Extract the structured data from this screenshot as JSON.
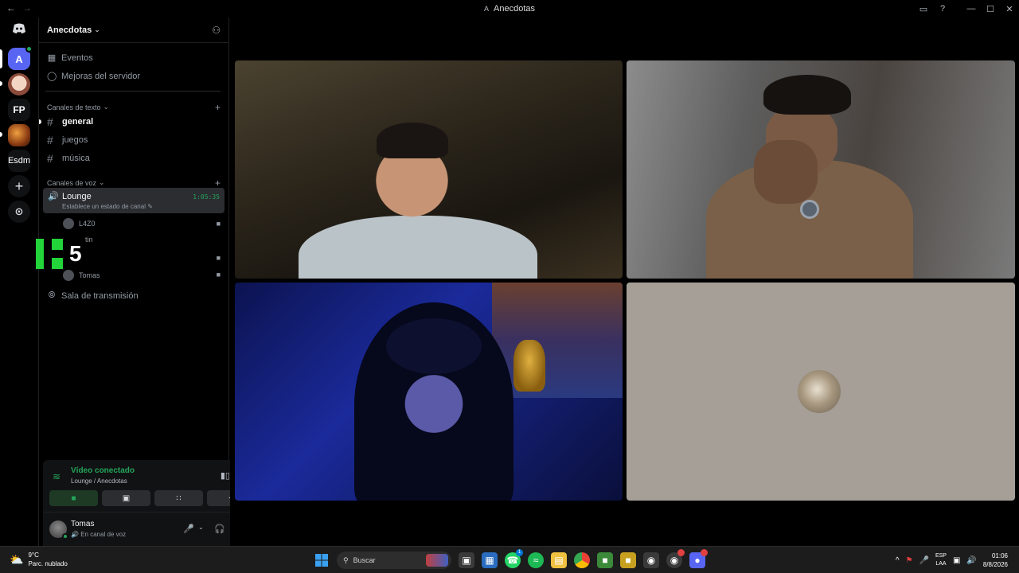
{
  "titlebar": {
    "back": "←",
    "forward": "→",
    "server_initial": "A",
    "title": "Anecdotas",
    "inbox_icon": "▭",
    "help_icon": "?",
    "minimize": "—",
    "maximize": "☐",
    "close": "✕"
  },
  "rail": {
    "servers": [
      {
        "label": "A"
      },
      {
        "label": "FP"
      },
      {
        "label": "Esdm"
      }
    ],
    "add": "+",
    "explore": "⊙"
  },
  "guild": {
    "name": "Anecdotas",
    "chevron": "⌄",
    "items": [
      {
        "label": "Eventos",
        "icon": "calendar-icon"
      },
      {
        "label": "Mejoras del servidor",
        "icon": "boost-icon"
      }
    ],
    "text_category": "Canales de texto",
    "text_channels": [
      {
        "name": "general",
        "active": true
      },
      {
        "name": "juegos",
        "active": false
      },
      {
        "name": "música",
        "active": false
      }
    ],
    "voice_category": "Canales de voz",
    "voice_channel": {
      "name": "Lounge",
      "timer": "1:05:35",
      "status": "Establece un estado de canal"
    },
    "voice_users": [
      {
        "name": "L4Z0"
      },
      {
        "name": "tin"
      },
      {
        "name": "Tomas"
      }
    ],
    "stage_channel": "Sala de transmisión",
    "overlay_number": "5"
  },
  "voice_panel": {
    "title": "Vídeo conectado",
    "subtitle": "Lounge / Anecdotas"
  },
  "user": {
    "name": "Tomas",
    "status": "En canal de voz"
  },
  "taskbar": {
    "temp": "9°C",
    "weather": "Parc. nublado",
    "search": "Buscar",
    "lang_line1": "ESP",
    "lang_line2": "LAA",
    "time": "01:06",
    "date": "8/8/2026",
    "whatsapp_badge": "1"
  }
}
